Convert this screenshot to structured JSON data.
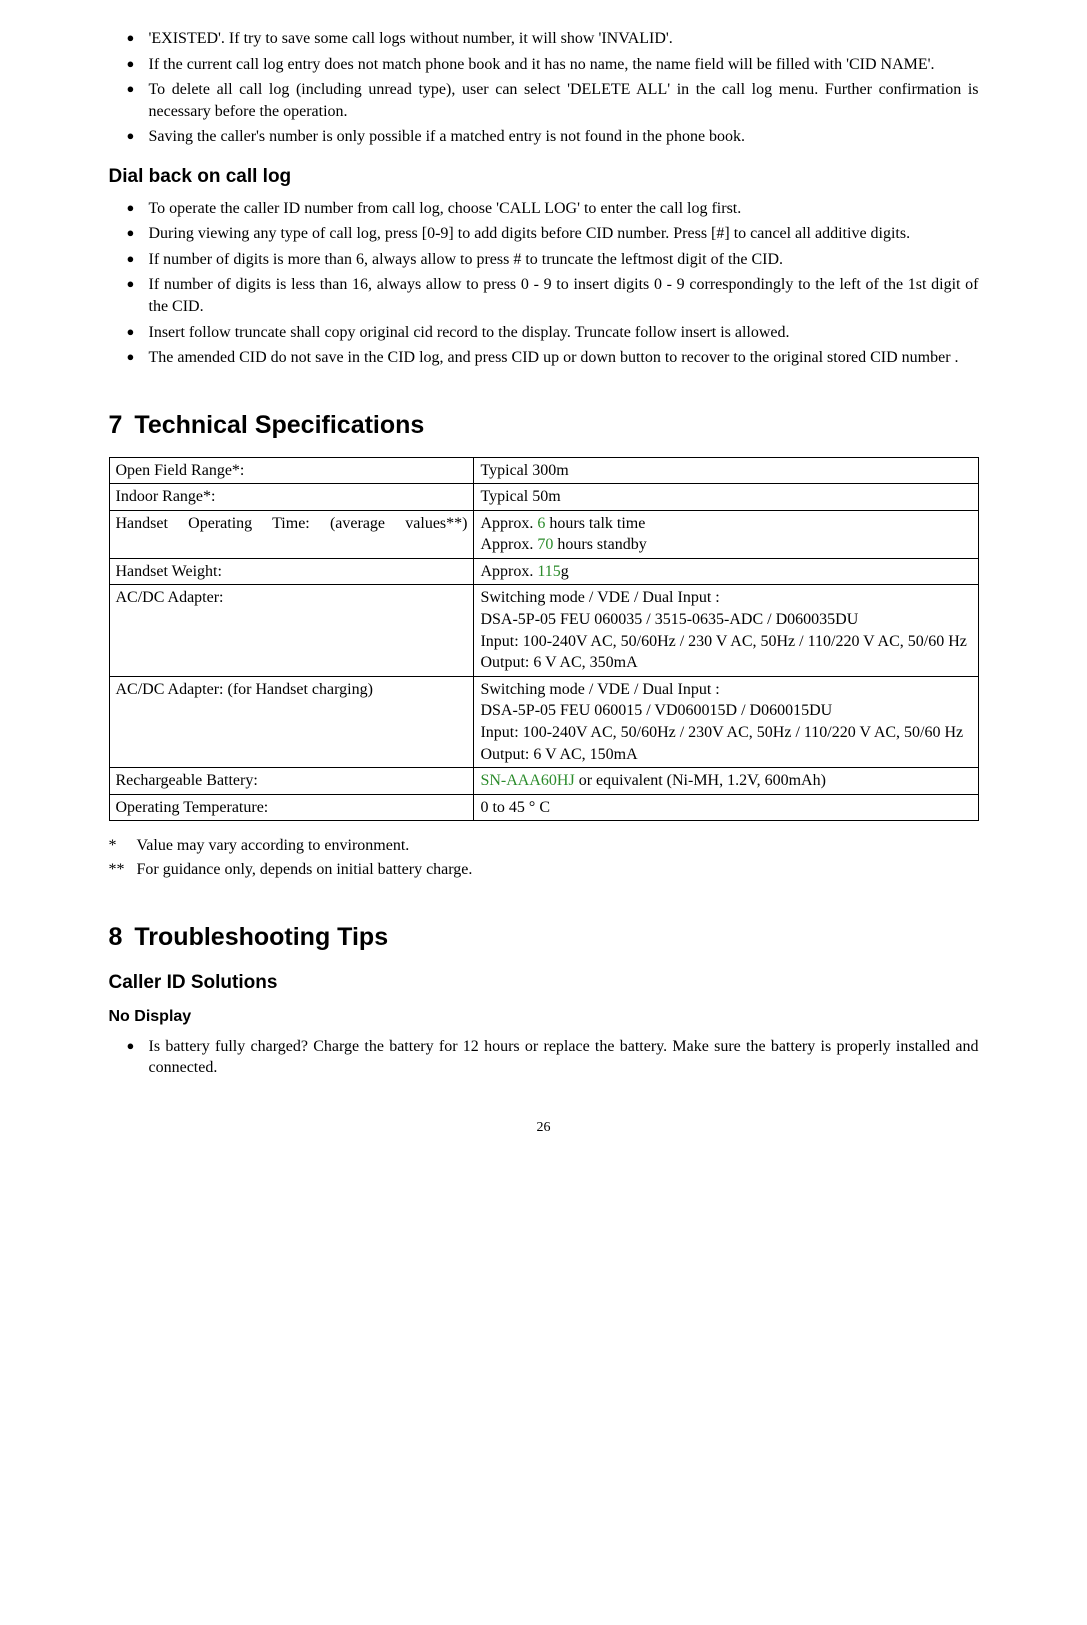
{
  "top_bullets": [
    "'EXISTED'. If try to save some call logs without number, it will show 'INVALID'.",
    "If the current call log entry does not match phone book and it has no name, the name field will be filled with 'CID NAME'.",
    "To delete all call log (including unread type), user can select 'DELETE ALL' in the call log menu. Further confirmation is necessary before the operation.",
    "Saving the caller's number is only possible if a matched entry is not found in the phone book."
  ],
  "dial_back_heading": "Dial back on call log",
  "dial_back_bullets": [
    "To operate the caller ID number from call log, choose 'CALL LOG' to enter the call log first.",
    "During viewing any type of call log, press [0-9] to add digits before CID number. Press [#] to cancel all additive digits.",
    "If number of digits is more than 6, always allow to press # to truncate the leftmost digit of the CID.",
    "If number of digits is less than 16, always allow to press 0 - 9 to insert digits 0 - 9 correspondingly to the left of the 1st digit of the CID.",
    "Insert follow truncate shall copy original cid record to the display. Truncate follow insert is allowed.",
    "The amended CID do not save in the CID log, and press  CID up or down button to recover  to the original  stored CID  number ."
  ],
  "section7_num": "7",
  "section7_title": "Technical Specifications",
  "spec_rows": [
    {
      "label": "Open Field Range*:",
      "value_pre": "Typical 300m",
      "hl": "",
      "value_post": ""
    },
    {
      "label": "Indoor Range*:",
      "value_pre": "Typical 50m",
      "hl": "",
      "value_post": ""
    },
    {
      "label": "Handset Operating Time: (average values**)",
      "value_pre": "Approx. ",
      "hl": "6",
      "value_post": " hours talk time",
      "line2_pre": "Approx. ",
      "line2_hl": "70",
      "line2_post": " hours standby",
      "label_wide": true
    },
    {
      "label": "Handset Weight:",
      "value_pre": "Approx. ",
      "hl": "115",
      "value_post": "g"
    },
    {
      "label": "AC/DC Adapter:",
      "value_pre": "Switching mode / VDE / Dual Input :\nDSA-5P-05 FEU 060035 / 3515-0635-ADC / D060035DU\nInput: 100-240V AC, 50/60Hz / 230 V AC, 50Hz / 110/220 V AC, 50/60 Hz\nOutput: 6 V AC, 350mA",
      "hl": "",
      "value_post": ""
    },
    {
      "label": "AC/DC Adapter: (for Handset charging)",
      "value_pre": "Switching mode / VDE / Dual Input :\nDSA-5P-05 FEU 060015 / VD060015D / D060015DU\nInput: 100-240V AC, 50/60Hz / 230V AC, 50Hz / 110/220 V AC,   50/60 Hz\nOutput: 6 V AC, 150mA",
      "hl": "",
      "value_post": ""
    },
    {
      "label": "Rechargeable Battery:",
      "value_pre": "",
      "hl": "SN-AAA60HJ",
      "value_post": " or equivalent (Ni-MH, 1.2V, 600mAh)"
    },
    {
      "label": "Operating Temperature:",
      "value_pre": "0 to 45 ° C",
      "hl": "",
      "value_post": ""
    }
  ],
  "footnotes": [
    {
      "mark": "*",
      "text": "Value may vary according to environment."
    },
    {
      "mark": "**",
      "text": "For guidance only, depends on initial battery charge."
    }
  ],
  "section8_num": "8",
  "section8_title": "Troubleshooting Tips",
  "caller_id_heading": "Caller ID Solutions",
  "no_display_heading": "No Display",
  "no_display_bullets": [
    "Is battery fully charged? Charge the battery for 12 hours or replace the battery. Make sure the battery is properly installed and connected."
  ],
  "page_number": "26"
}
